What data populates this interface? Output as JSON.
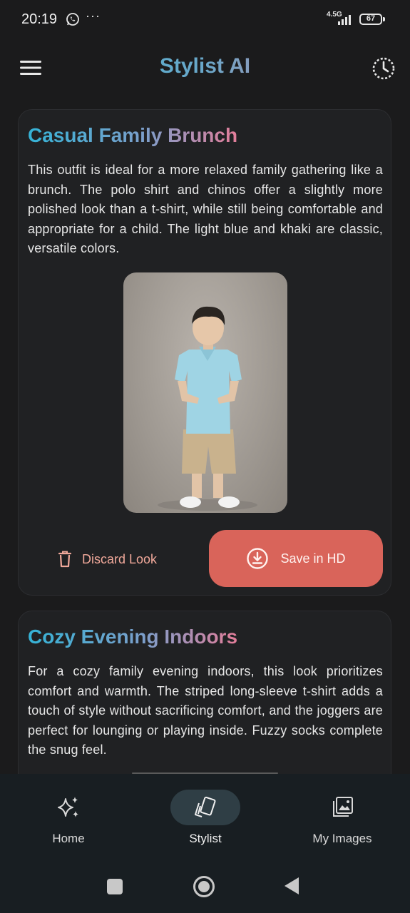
{
  "status_bar": {
    "time": "20:19",
    "more": "···",
    "network": "4.5G",
    "battery": "67"
  },
  "app_bar": {
    "title": "Stylist AI"
  },
  "cards": [
    {
      "title": "Casual Family Brunch",
      "description": "This outfit is ideal for a more relaxed family gathering like a brunch. The polo shirt and chinos offer a slightly more polished look than a t-shirt, while still being comfortable and appropriate for a child. The light blue and khaki are classic, versatile colors.",
      "discard_label": "Discard Look",
      "save_label": "Save in HD"
    },
    {
      "title": "Cozy Evening Indoors",
      "description": "For a cozy family evening indoors, this look prioritizes comfort and warmth. The striped long-sleeve t-shirt adds a touch of style without sacrificing comfort, and the joggers are perfect for lounging or playing inside. Fuzzy socks complete the snug feel."
    }
  ],
  "bottom_nav": {
    "items": [
      {
        "label": "Home",
        "icon": "sparkles-icon",
        "active": false
      },
      {
        "label": "Stylist",
        "icon": "cards-icon",
        "active": true
      },
      {
        "label": "My Images",
        "icon": "gallery-icon",
        "active": false
      }
    ]
  },
  "colors": {
    "background": "#1b1b1c",
    "card": "#202123",
    "accent": "#d9645a",
    "title_gradient_start": "#35b3d6",
    "title_gradient_end": "#e47e9a",
    "nav_active": "#2f3e45"
  }
}
